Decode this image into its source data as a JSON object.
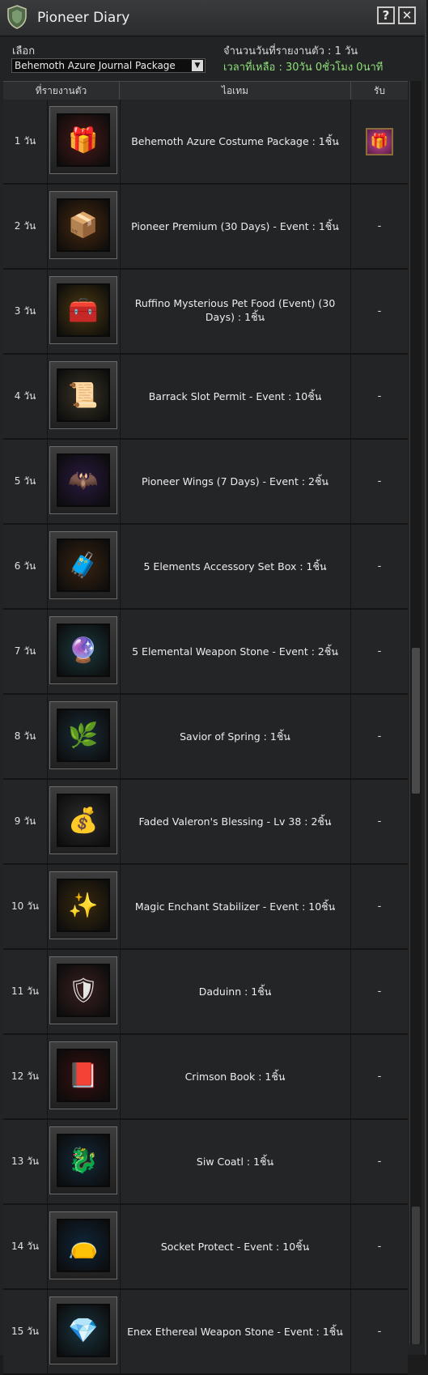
{
  "window": {
    "title": "Pioneer Diary",
    "help_label": "?",
    "close_label": "✕"
  },
  "header": {
    "select_label": "เลือก",
    "selected_package": "Behemoth Azure Journal Package",
    "days_reported": "จำนวนวันที่รายงานตัว : 1 วัน",
    "time_remaining": "เวลาที่เหลือ : 30วัน 0ชั่วโมง 0นาที"
  },
  "columns": {
    "day": "ที่รายงานตัว",
    "item": "ไอเทม",
    "receive": "รับ"
  },
  "rows": [
    {
      "day": "1 วัน",
      "item": "Behemoth Azure Costume Package : 1ชิ้น",
      "status": "",
      "icon": "gift-box-icon",
      "bg": "#4b1a1a",
      "glyph": "🎁"
    },
    {
      "day": "2 วัน",
      "item": "Pioneer Premium (30 Days) - Event : 1ชิ้น",
      "status": "-",
      "icon": "premium-chest-icon",
      "bg": "#4a2a10",
      "glyph": "📦"
    },
    {
      "day": "3 วัน",
      "item": "Ruffino Mysterious Pet Food (Event) (30 Days) : 1ชิ้น",
      "status": "-",
      "icon": "treasure-chest-icon",
      "bg": "#4d3a12",
      "glyph": "🧰"
    },
    {
      "day": "4 วัน",
      "item": "Barrack Slot Permit - Event : 10ชิ้น",
      "status": "-",
      "icon": "permit-scroll-icon",
      "bg": "#3a3526",
      "glyph": "📜"
    },
    {
      "day": "5 วัน",
      "item": "Pioneer Wings (7 Days) - Event : 2ชิ้น",
      "status": "-",
      "icon": "wings-icon",
      "bg": "#2a1a40",
      "glyph": "🦇"
    },
    {
      "day": "6 วัน",
      "item": "5 Elements Accessory Set Box : 1ชิ้น",
      "status": "-",
      "icon": "accessory-box-icon",
      "bg": "#3a2412",
      "glyph": "🧳"
    },
    {
      "day": "7 วัน",
      "item": "5 Elemental Weapon Stone - Event : 2ชิ้น",
      "status": "-",
      "icon": "crystal-ball-icon",
      "bg": "#1c3a40",
      "glyph": "🔮"
    },
    {
      "day": "8 วัน",
      "item": "Savior of Spring : 1ชิ้น",
      "status": "-",
      "icon": "spring-figure-icon",
      "bg": "#1a2e3a",
      "glyph": "🌿"
    },
    {
      "day": "9 วัน",
      "item": "Faded Valeron's Blessing - Lv 38 : 2ชิ้น",
      "status": "-",
      "icon": "blessing-pouch-icon",
      "bg": "#2e2e30",
      "glyph": "💰"
    },
    {
      "day": "10 วัน",
      "item": "Magic Enchant Stabilizer - Event : 10ชิ้น",
      "status": "-",
      "icon": "enchant-pouch-icon",
      "bg": "#3a2a10",
      "glyph": "✨"
    },
    {
      "day": "11 วัน",
      "item": "Daduinn : 1ชิ้น",
      "status": "-",
      "icon": "daduinn-emblem-icon",
      "bg": "#3a2020",
      "glyph": "🛡"
    },
    {
      "day": "12 วัน",
      "item": "Crimson Book : 1ชิ้น",
      "status": "-",
      "icon": "crimson-book-icon",
      "bg": "#3a1010",
      "glyph": "📕"
    },
    {
      "day": "13 วัน",
      "item": "Siw Coatl : 1ชิ้น",
      "status": "-",
      "icon": "siw-coatl-emblem-icon",
      "bg": "#152a3a",
      "glyph": "🐉"
    },
    {
      "day": "14 วัน",
      "item": "Socket Protect - Event : 10ชิ้น",
      "status": "-",
      "icon": "socket-pouch-icon",
      "bg": "#10263a",
      "glyph": "👝"
    },
    {
      "day": "15 วัน",
      "item": "Enex Ethereal Weapon Stone - Event : 1ชิ้น",
      "status": "-",
      "icon": "weapon-stone-icon",
      "bg": "#1a3440",
      "glyph": "💎"
    }
  ],
  "first_row_reward_icon": "pink-gift-icon"
}
